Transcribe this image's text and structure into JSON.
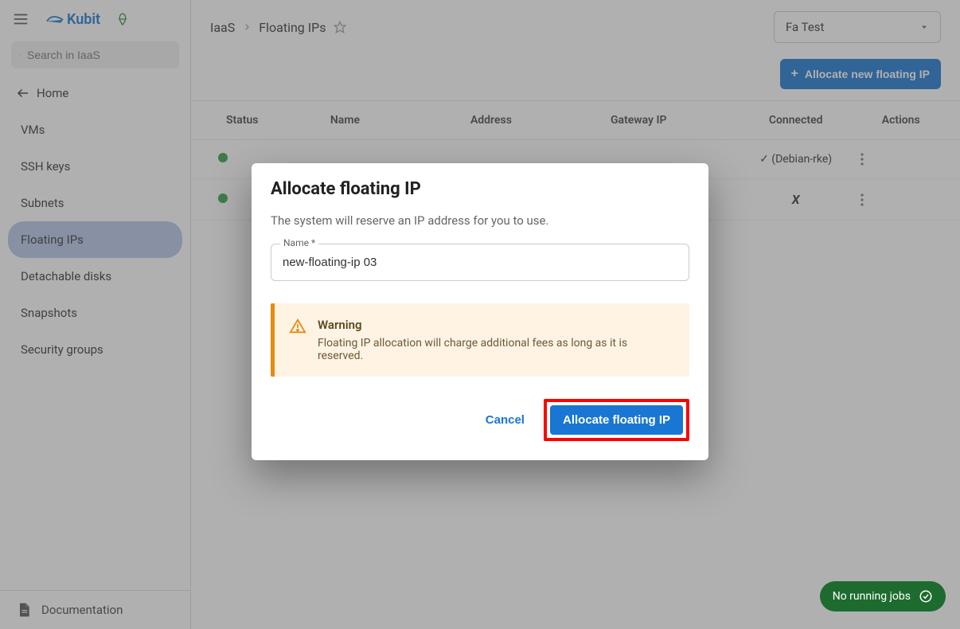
{
  "logo": "Kubit",
  "search": {
    "placeholder": "Search in IaaS"
  },
  "home_label": "Home",
  "sidebar": {
    "items": [
      {
        "label": "VMs"
      },
      {
        "label": "SSH keys"
      },
      {
        "label": "Subnets"
      },
      {
        "label": "Floating IPs"
      },
      {
        "label": "Detachable disks"
      },
      {
        "label": "Snapshots"
      },
      {
        "label": "Security groups"
      }
    ],
    "doc_label": "Documentation"
  },
  "breadcrumb": {
    "root": "IaaS",
    "current": "Floating IPs"
  },
  "project_selector": {
    "value": "Fa Test"
  },
  "allocate_button": "Allocate new floating IP",
  "table": {
    "headers": {
      "status": "Status",
      "name": "Name",
      "address": "Address",
      "gatewayip": "Gateway IP",
      "connected": "Connected",
      "actions": "Actions"
    },
    "rows": [
      {
        "connected": "✓ (Debian-rke)"
      },
      {
        "connected": "✗"
      }
    ]
  },
  "modal": {
    "title": "Allocate floating IP",
    "description": "The system will reserve an IP address for you to use.",
    "name_label": "Name *",
    "name_value": "new-floating-ip 03",
    "warning_title": "Warning",
    "warning_text": "Floating IP allocation will charge additional fees as long as it is reserved.",
    "cancel": "Cancel",
    "confirm": "Allocate floating IP"
  },
  "jobs": {
    "label": "No running jobs"
  }
}
